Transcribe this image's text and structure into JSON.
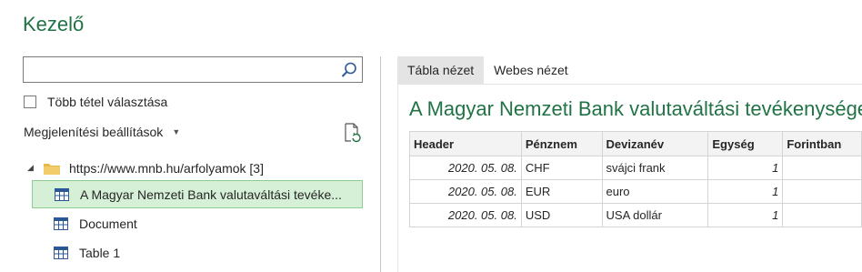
{
  "app": {
    "title": "Kezelő"
  },
  "navigator": {
    "search_placeholder": "",
    "multi_select_label": "Több tétel választása",
    "display_options_label": "Megjelenítési beállítások",
    "tree": {
      "root": {
        "label": "https://www.mnb.hu/arfolyamok [3]"
      },
      "items": [
        {
          "label": "A Magyar Nemzeti Bank valutaváltási tevéke...",
          "selected": true
        },
        {
          "label": "Document",
          "selected": false
        },
        {
          "label": "Table 1",
          "selected": false
        }
      ]
    }
  },
  "preview": {
    "tabs": [
      {
        "label": "Tábla nézet",
        "active": true
      },
      {
        "label": "Webes nézet",
        "active": false
      }
    ],
    "title": "A Magyar Nemzeti Bank valutaváltási tevékenységet n",
    "table": {
      "headers": [
        "Header",
        "Pénznem",
        "Devizanév",
        "Egység",
        "Forintban"
      ],
      "rows": [
        [
          "2020. 05. 08.",
          "CHF",
          "svájci frank",
          "1",
          ""
        ],
        [
          "2020. 05. 08.",
          "EUR",
          "euro",
          "1",
          ""
        ],
        [
          "2020. 05. 08.",
          "USD",
          "USA dollár",
          "1",
          ""
        ]
      ]
    }
  },
  "colors": {
    "accent": "#217346",
    "selected_bg": "#d6f0d7",
    "selected_border": "#8fce90"
  }
}
